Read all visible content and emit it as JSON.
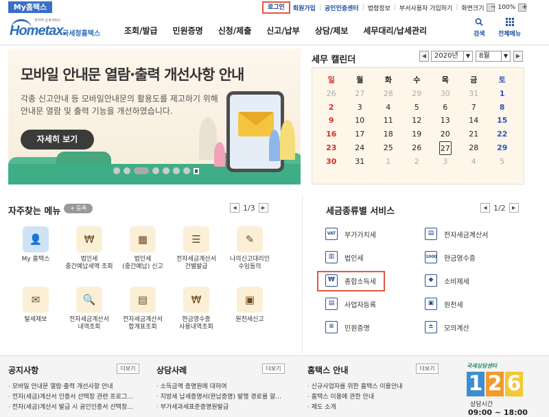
{
  "topbar": {
    "my_tab": "My홈택스",
    "links": [
      "로그인",
      "회원가입",
      "공인인증센터",
      "법령정보",
      "부서사용자 가입하기",
      "화면크기"
    ],
    "zoom_minus": "−",
    "zoom_value": "100%",
    "zoom_plus": "+"
  },
  "header": {
    "logo_small": "전자적 납세서비스",
    "logo_home": "Hometax.",
    "logo_nts": "국세청홈택스",
    "nav": [
      "조회/발급",
      "민원증명",
      "신청/제출",
      "신고/납부",
      "상담/제보",
      "세무대리/납세관리"
    ],
    "search_label": "검색",
    "menu_label": "전체메뉴"
  },
  "banner": {
    "title": "모바일 안내문 열람·출력 개선사항 안내",
    "desc_line1": "각종 신고안내 등 모바일안내문의 활용도를 제고하기 위해",
    "desc_line2": "안내문 열람 및 출력 기능을 개선하였습니다.",
    "button": "자세히 보기"
  },
  "calendar": {
    "title": "세무 캘린더",
    "year": "2020년",
    "month": "8월",
    "weekdays": [
      "일",
      "월",
      "화",
      "수",
      "목",
      "금",
      "토"
    ],
    "weeks": [
      [
        "26",
        "27",
        "28",
        "29",
        "30",
        "31",
        "1"
      ],
      [
        "2",
        "3",
        "4",
        "5",
        "6",
        "7",
        "8"
      ],
      [
        "9",
        "10",
        "11",
        "12",
        "13",
        "14",
        "15"
      ],
      [
        "16",
        "17",
        "18",
        "19",
        "20",
        "21",
        "22"
      ],
      [
        "23",
        "24",
        "25",
        "26",
        "27",
        "28",
        "29"
      ],
      [
        "30",
        "31",
        "1",
        "2",
        "3",
        "4",
        "5"
      ]
    ],
    "today": "27"
  },
  "favorites": {
    "title": "자주찾는 메뉴",
    "register": "+ 등록",
    "page": "1/3",
    "items": [
      {
        "line1": "My 홈택스",
        "line2": ""
      },
      {
        "line1": "법인세",
        "line2": "중간예납세액 조회"
      },
      {
        "line1": "법인세",
        "line2": "(중간예납) 신고"
      },
      {
        "line1": "전자세금계산서",
        "line2": "건별발급"
      },
      {
        "line1": "나의신고대리인",
        "line2": "수임동의"
      },
      {
        "line1": "탈세제보",
        "line2": ""
      },
      {
        "line1": "전자세금계산서",
        "line2": "내역조회"
      },
      {
        "line1": "전자세금계산서",
        "line2": "합계표조회"
      },
      {
        "line1": "현금영수증",
        "line2": "사용내역조회"
      },
      {
        "line1": "원천세신고",
        "line2": ""
      }
    ]
  },
  "tax_services": {
    "title": "세금종류별 서비스",
    "page": "1/2",
    "left": [
      "부가가치세",
      "법인세",
      "종합소득세",
      "사업자등록",
      "민원증명"
    ],
    "right": [
      "전자세금계산서",
      "현금영수증",
      "소비제세",
      "원천세",
      "모의계산"
    ]
  },
  "notices": {
    "title": "공지사항",
    "more": "더보기",
    "items": [
      "모바일 안내문 열람·출력 개선사항 안내",
      "전자(세금)계산서 인증서 선택창 관련 프로그...",
      "전자(세금)계산서 발급 시 공인인증서 선택창..."
    ]
  },
  "cases": {
    "title": "상담사례",
    "more": "더보기",
    "items": [
      "소득금액 증명원에 대하여",
      "지방세 납세증명서(완납증명) 발행 경로를 알...",
      "부가세과세표준증명원발급"
    ]
  },
  "guide": {
    "title": "홈택스 안내",
    "more": "더보기",
    "items": [
      "신규사업자를 위한 홈택스 이용안내",
      "홈택스 이용에 관한 안내",
      "제도 소개"
    ]
  },
  "center": {
    "caption": "국세상담센터",
    "digits": [
      "1",
      "2",
      "6"
    ],
    "hours_label": "상담시간",
    "hours": "09:00 ~ 18:00"
  },
  "colors": {
    "brand_blue": "#2e6db8",
    "highlight_red": "#e0553f",
    "sunday": "#d62d2d",
    "saturday": "#2c58b5"
  }
}
